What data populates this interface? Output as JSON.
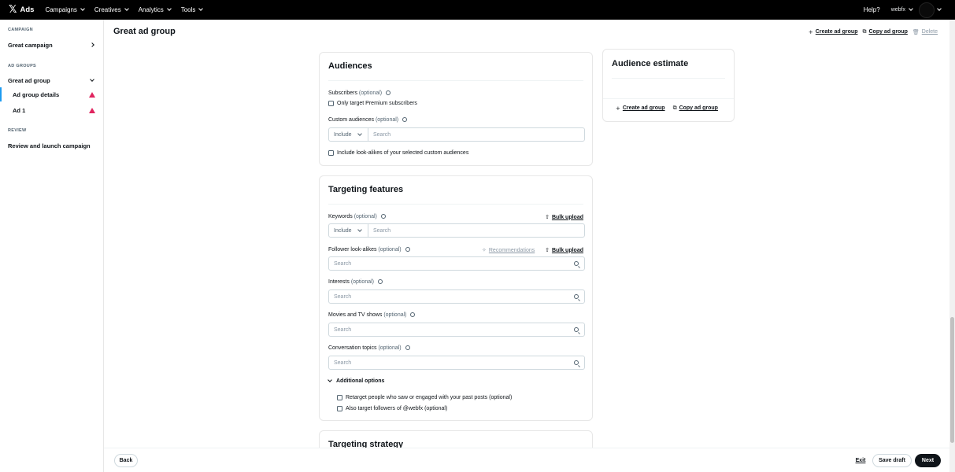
{
  "topnav": {
    "logo": "𝕏",
    "brand": "Ads",
    "menu": [
      "Campaigns",
      "Creatives",
      "Analytics",
      "Tools"
    ],
    "help": "Help?",
    "account": "webfx"
  },
  "sidebar": {
    "campaign_section": "CAMPAIGN",
    "campaign_name": "Great campaign",
    "adgroups_section": "AD GROUPS",
    "adgroup_name": "Great ad group",
    "adgroup_details": "Ad group details",
    "ad_item": "Ad 1",
    "review_section": "REVIEW",
    "review_item": "Review and launch campaign"
  },
  "header": {
    "title": "Great ad group",
    "create": "Create ad group",
    "copy": "Copy ad group",
    "delete": "Delete"
  },
  "audiences": {
    "title": "Audiences",
    "subscribers_label": "Subscribers",
    "optional": "(optional)",
    "premium_only": "Only target Premium subscribers",
    "custom_label": "Custom audiences",
    "include": "Include",
    "search_placeholder": "Search",
    "lookalikes": "Include look-alikes of your selected custom audiences"
  },
  "targeting": {
    "title": "Targeting features",
    "keywords_label": "Keywords",
    "bulk_upload": "Bulk upload",
    "follower_label": "Follower look-alikes",
    "recommendations": "Recommendations",
    "interests_label": "Interests",
    "movies_label": "Movies and TV shows",
    "conversation_label": "Conversation topics",
    "additional": "Additional options",
    "retarget": "Retarget people who saw or engaged with your past posts (optional)",
    "followers_of": "Also target followers of @webfx (optional)"
  },
  "strategy": {
    "title": "Targeting strategy"
  },
  "estimate": {
    "title": "Audience estimate",
    "create": "Create ad group",
    "copy": "Copy ad group"
  },
  "footer": {
    "back": "Back",
    "exit": "Exit",
    "save_draft": "Save draft",
    "next": "Next"
  },
  "colors": {
    "accent": "#1d9bf0",
    "warning": "#e0245e",
    "topbar": "#000000"
  }
}
